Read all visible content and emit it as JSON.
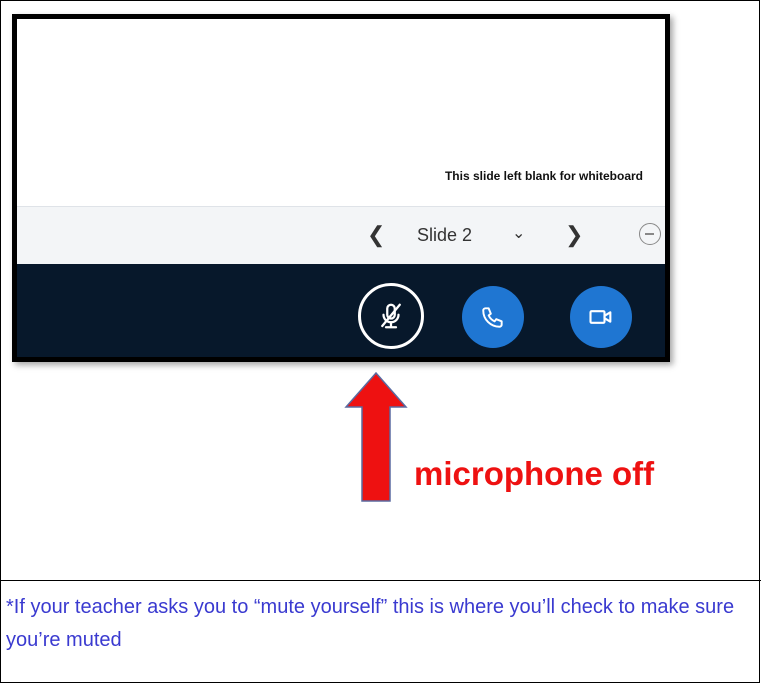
{
  "slide": {
    "text": "This slide left blank for whiteboard"
  },
  "slide_nav": {
    "prev_icon": "chevron-left-icon",
    "label": "Slide 2",
    "caret_icon": "chevron-down-icon",
    "next_icon": "chevron-right-icon",
    "zoom_icon": "zoom-out-icon"
  },
  "action_bar": {
    "mic_icon": "microphone-off-icon",
    "phone_icon": "phone-icon",
    "video_icon": "video-camera-icon",
    "button_color": "#1f76d2",
    "bar_color": "#07182b"
  },
  "annotation": {
    "callout": "microphone off",
    "arrow_color": "#ee1111"
  },
  "note": {
    "text": "*If your teacher asks you to “mute yourself” this is where you’ll check to make sure you’re muted"
  }
}
